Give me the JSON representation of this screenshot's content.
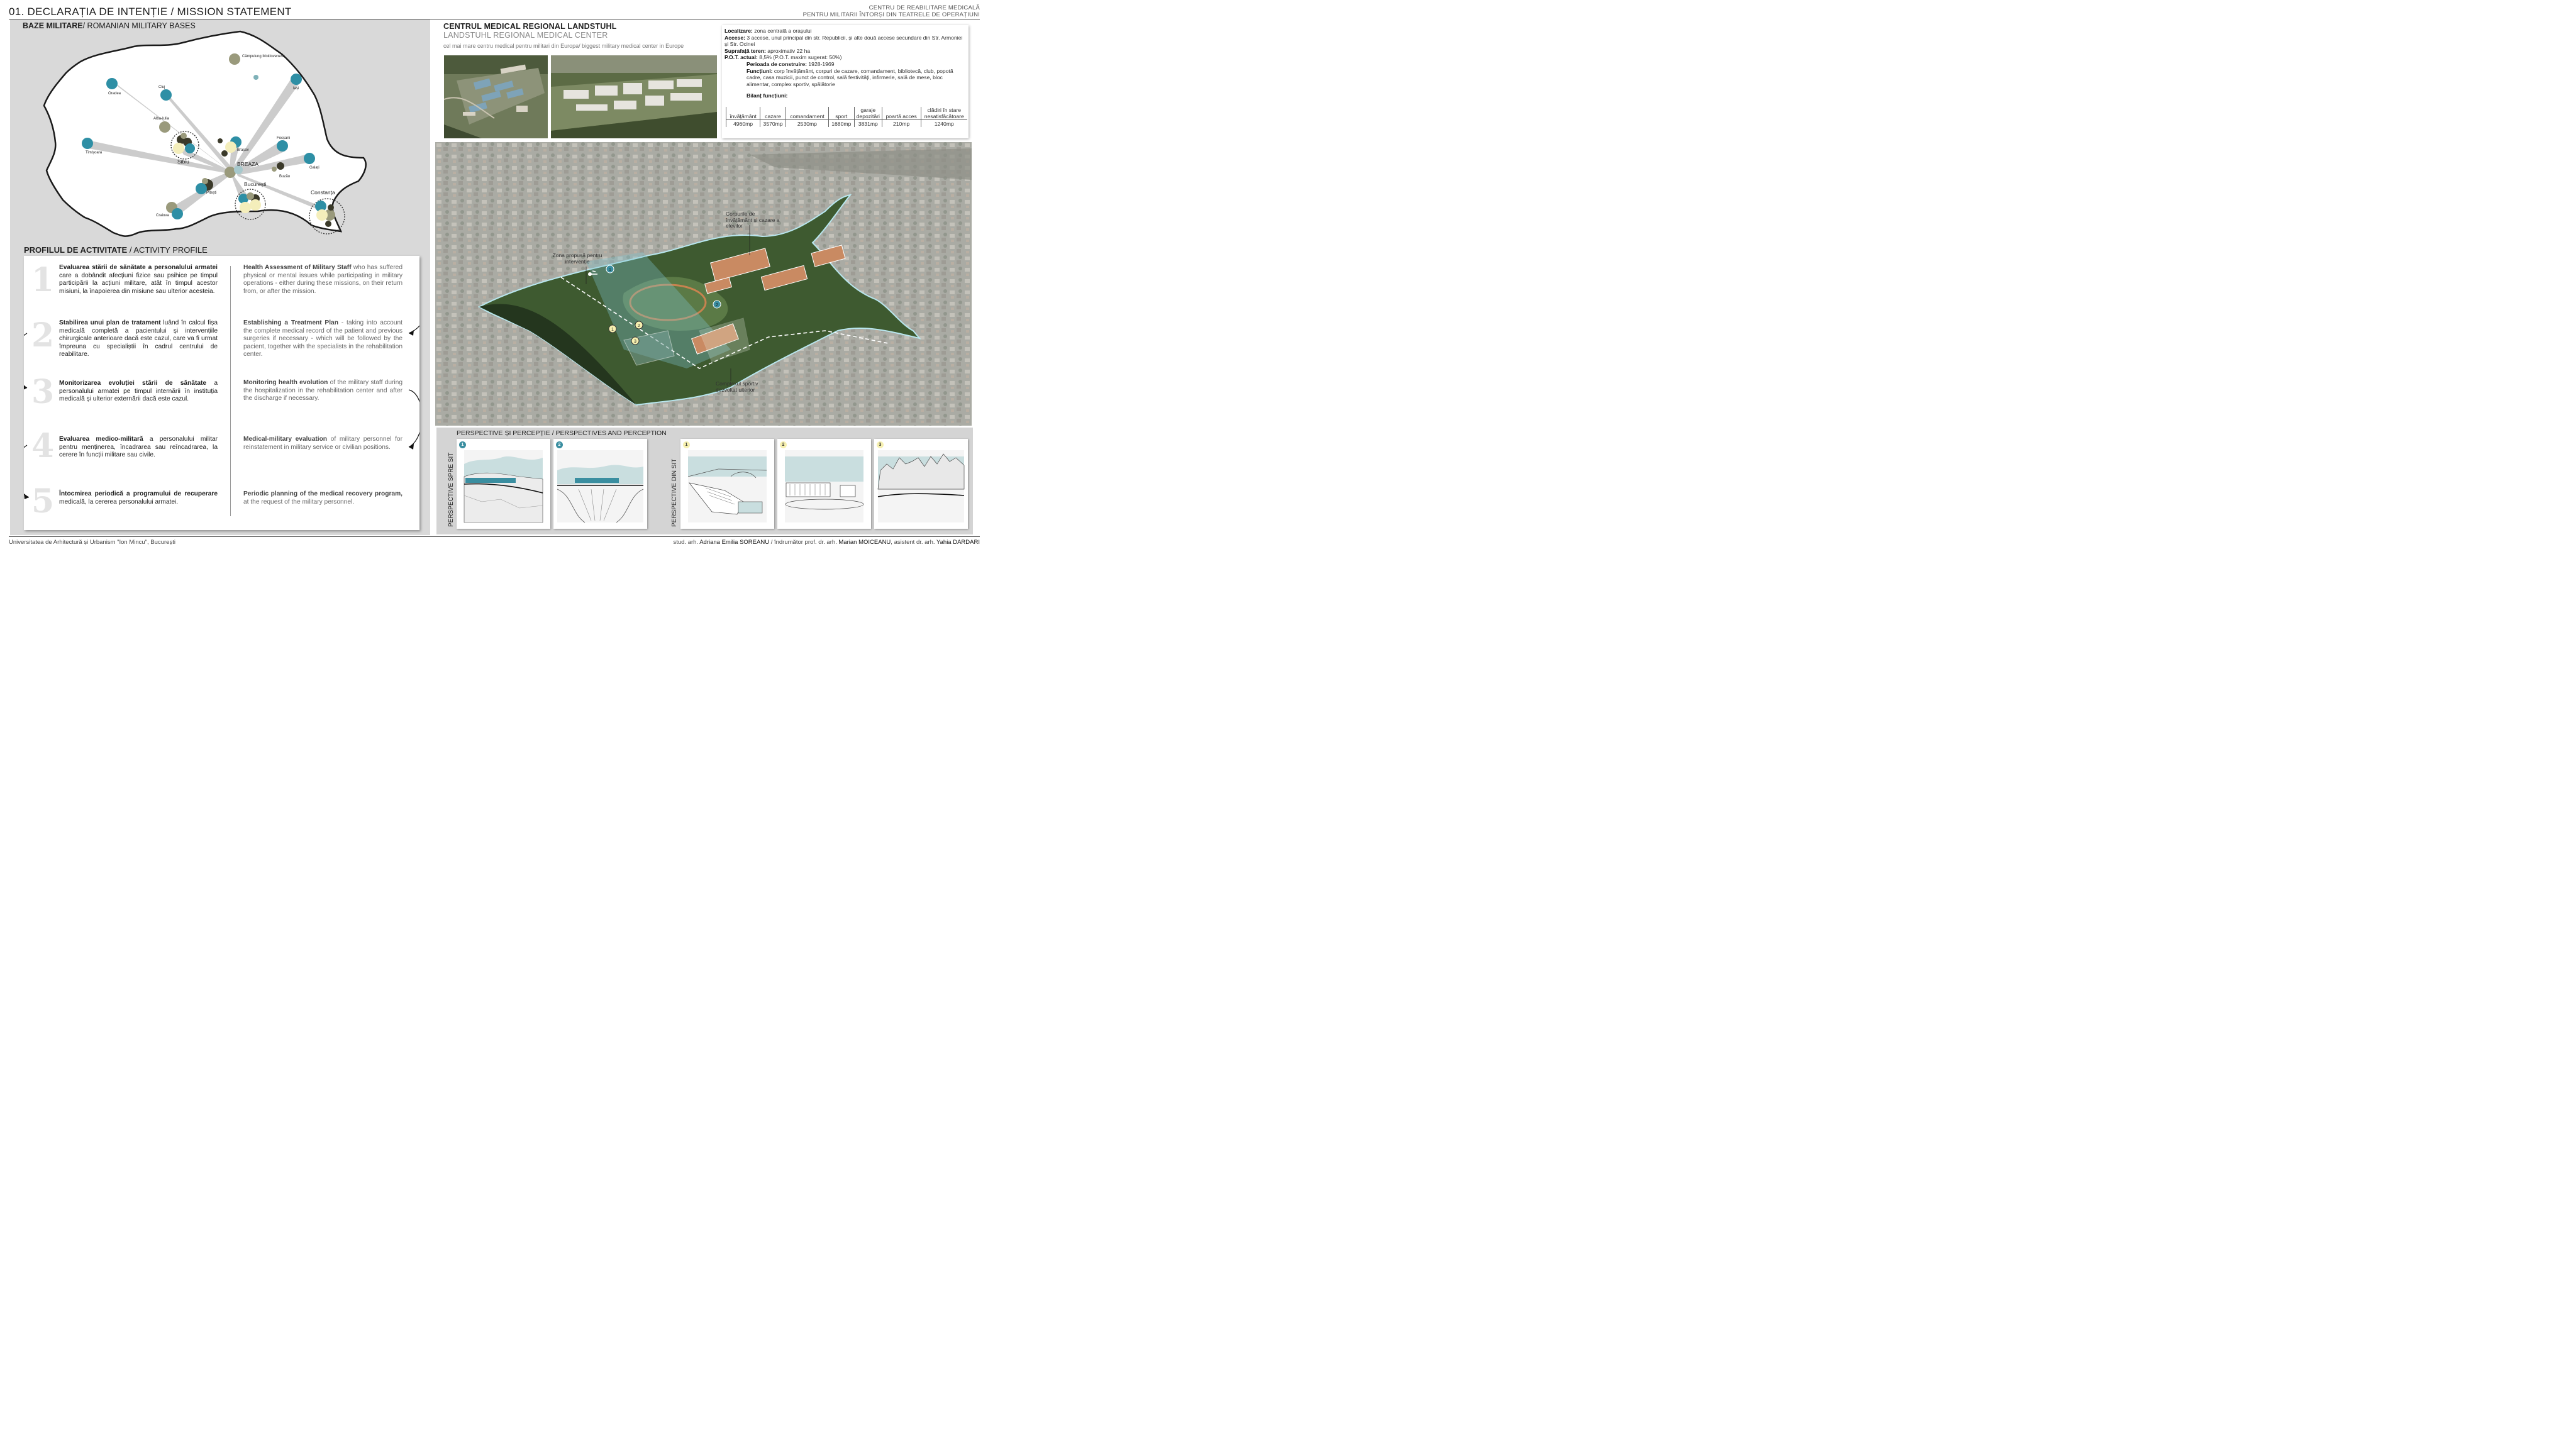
{
  "header": {
    "title_main": "01. DECLARAȚIA DE INTENȚIE",
    "title_sub": "/ MISSION STATEMENT",
    "right_line1": "CENTRU DE REABILITARE MEDICALĂ",
    "right_line2": "PENTRU MILITARII ÎNTORȘI DIN TEATRELE DE OPERAȚIUNI"
  },
  "map": {
    "title_bold": "BAZE MILITARE",
    "title_rest": "/ ROMANIAN MILITARY BASES",
    "cities": {
      "campulung": "Câmpulung Moldovenesc",
      "oradea": "Oradea",
      "cluj": "Cluj",
      "iasi": "Iași",
      "alba": "Alba-Iulia",
      "timisoara": "Timișoara",
      "sibiu": "Sibiu",
      "brasov": "Brașov",
      "focsani": "Focșani",
      "galati": "Galați",
      "breaza": "BREAZA",
      "buzau": "Buzău",
      "bucuresti": "București",
      "pitesti": "Pitești",
      "craiova": "Craiova",
      "constanta": "Constanța"
    },
    "colors": {
      "teal": "#2e8fa5",
      "olive": "#9a9a7c",
      "dark": "#3b3a2a",
      "cream": "#f4eebb",
      "beam": "#c4c4c4"
    }
  },
  "activity": {
    "title_bold": "PROFILUL DE ACTIVITATE",
    "title_rest": "/ ACTIVITY PROFILE",
    "items": [
      {
        "num": "1",
        "ro_bold": "Evaluarea stării de sănătate a personalului armatei",
        "ro_rest": " care a dobândit afecțiuni fizice sau psihice pe timpul participării la acțiuni militare, atât în timpul acestor misiuni, la înapoierea din misiune sau ulterior acesteia.",
        "en_bold": "Health Assessment of Military Staff",
        "en_rest": " who has suffered physical or mental issues while participating in military operations - either during these missions, on their return from, or after the mission."
      },
      {
        "num": "2",
        "ro_bold": "Stabilirea unui plan de tratament",
        "ro_rest": " luând în calcul fișa medicală completă a pacientului și intervențiile chirurgicale anterioare dacă este cazul, care va fi urmat împreuna cu specialiștii în cadrul centrului de reabilitare.",
        "en_bold": "Establishing a Treatment Plan",
        "en_rest": " - taking into account the complete medical record of the patient and previous surgeries if necessary - which will be followed by the pacient, together with the specialists in the rehabilitation center."
      },
      {
        "num": "3",
        "ro_bold": "Monitorizarea evoluției stării de sănătate",
        "ro_rest": " a personalului armatei pe timpul internării în instituția medicală și ulterior externării dacă este cazul.",
        "en_bold": "Monitoring health evolution",
        "en_rest": " of the military staff during the hospitalization in the rehabilitation center and after the discharge if necessary."
      },
      {
        "num": "4",
        "ro_bold": "Evaluarea medico-militară",
        "ro_rest": " a personalului militar pentru menținerea, încadrarea sau reîncadrarea, la cerere în funcții militare sau civile.",
        "en_bold": "Medical-military evaluation",
        "en_rest": " of military personnel for reinstatement in military service or civilian positions."
      },
      {
        "num": "5",
        "ro_bold": "Întocmirea periodică a programului de recuperare",
        "ro_rest": " medicală, la cererea personalului armatei.",
        "en_bold": "Periodic planning of the medical recovery program,",
        "en_rest": " at the request of the military personnel."
      }
    ]
  },
  "center": {
    "title": "CENTRUL MEDICAL REGIONAL LANDSTUHL",
    "subtitle": "LANDSTUHL REGIONAL MEDICAL CENTER",
    "desc": "cel mai mare centru medical pentru militari din Europa/ biggest military medical center in Europe"
  },
  "info": {
    "localizare_label": "Localizare:",
    "localizare": " zona centrală a orașului",
    "accese_label": "Accese:",
    "accese": " 3 accese, unul principal din str. Republicii, și alte două accese secundare din Str. Armoniei și Str. Ocinei",
    "suprafata_label": "Suprafață teren:",
    "suprafata": " aproximativ 22 ha",
    "pot_label": "P.O.T. actual:",
    "pot": " 8,5% (P.O.T. maxim sugerat: 50%)",
    "perioada_label": "Perioada de construire:",
    "perioada": " 1928-1969",
    "functiuni_label": "Funcțiuni:",
    "functiuni": " corp învățământ, corpuri de cazare, comandament, bibliotecă, club, popotă cadre, casa muzicii, punct de control, sală festivități, infirmerie, sală de mese, bloc alimentar, complex sportiv, spălătorie",
    "bilant_label": "Bilanț funcțiuni:",
    "bilant_headers": [
      "învățământ",
      "cazare",
      "comandament",
      "sport",
      "garaje depozitări",
      "poartă acces",
      "clădiri în stare nesatisfăcătoare"
    ],
    "bilant_values": [
      "4960mp",
      "3570mp",
      "2530mp",
      "1680mp",
      "3831mp",
      "210mp",
      "1240mp"
    ]
  },
  "aerial": {
    "anno_cladiri": "Corpurile de învățământ și cazare a elevilor",
    "anno_zona": "Zona propusă pentru intervenție",
    "anno_sport": "Complexul sportiv dezvoltat ulterior",
    "markers": [
      "1",
      "2",
      "1",
      "2",
      "3"
    ]
  },
  "perspectives": {
    "title": "PERSPECTIVE ȘI PERCEPȚIE",
    "title_rest": " / PERSPECTIVES AND PERCEPTION",
    "label_spre": "PERSPECTIVE SPRE SIT",
    "label_din": "PERSPECTIVE DIN SIT",
    "card_numbers": [
      "1",
      "2",
      "1",
      "2",
      "3"
    ]
  },
  "footer": {
    "left": "Universitatea de Arhitectură și Urbanism \"Ion Mincu\", București",
    "right_pre": "stud. arh. ",
    "student": "Adriana Emilia SOREANU",
    "mid": " / îndrumător prof. dr. arh. ",
    "tutor": "Marian MOICEANU",
    "mid2": ", asistent dr. arh. ",
    "assistant": "Yahia DARDARI"
  }
}
